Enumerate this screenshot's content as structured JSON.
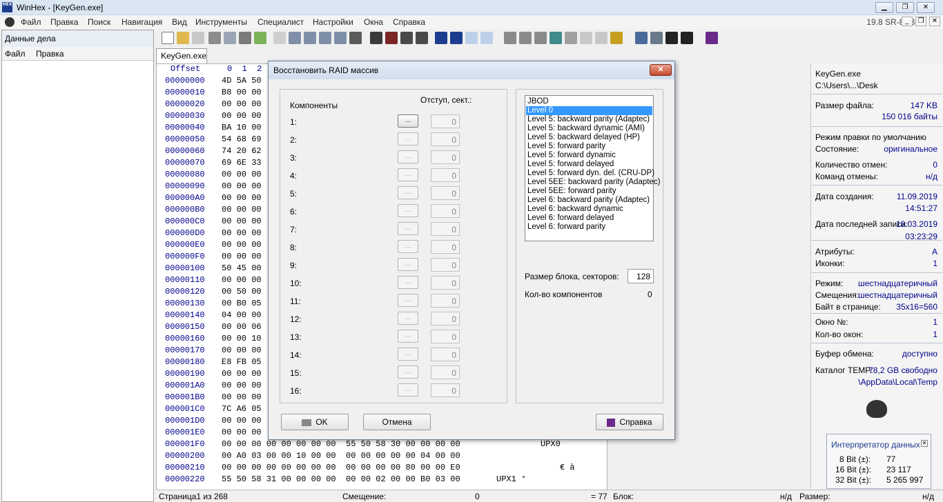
{
  "window": {
    "title": "WinHex - [KeyGen.exe]",
    "icon_text": "HEX"
  },
  "menu": [
    "Файл",
    "Правка",
    "Поиск",
    "Навигация",
    "Вид",
    "Инструменты",
    "Специалист",
    "Настройки",
    "Окна",
    "Справка"
  ],
  "version": "19.8 SR-8 x86",
  "case_panel": {
    "title": "Данные дела",
    "menu": [
      "Файл",
      "Правка"
    ]
  },
  "tab": "KeyGen.exe",
  "hex": {
    "header": {
      "offset": "Offset",
      "cols": "0  1  2"
    },
    "offsets": [
      "00000000",
      "00000010",
      "00000020",
      "00000030",
      "00000040",
      "00000050",
      "00000060",
      "00000070",
      "00000080",
      "00000090",
      "000000A0",
      "000000B0",
      "000000C0",
      "000000D0",
      "000000E0",
      "000000F0",
      "00000100",
      "00000110",
      "00000120",
      "00000130",
      "00000140",
      "00000150",
      "00000160",
      "00000170",
      "00000180",
      "00000190",
      "000001A0",
      "000001B0",
      "000001C0",
      "000001D0",
      "000001E0",
      "000001F0",
      "00000200",
      "00000210",
      "00000220"
    ],
    "bytes": [
      "4D 5A 50",
      "B8 00 00",
      "00 00 00",
      "00 00 00",
      "BA 10 00",
      "54 68 69",
      "74 20 62",
      "69 6E 33",
      "00 00 00",
      "00 00 00",
      "00 00 00",
      "00 00 00",
      "00 00 00",
      "00 00 00",
      "00 00 00",
      "00 00 00",
      "50 45 00",
      "00 00 00",
      "00 50 00",
      "00 B0 05",
      "04 00 00",
      "00 00 06",
      "00 00 10",
      "00 00 00",
      "E8 FB 05",
      "00 00 00",
      "00 00 00",
      "00 00 00",
      "7C A6 05",
      "00 00 00",
      "00 00 00",
      "00 00 00 00 00 00 00 00  55 50 58 30 00 00 00 00",
      "00 A0 03 00 00 10 00 00  00 00 00 00 00 04 00 00",
      "00 00 00 00 00 00 00 00  00 00 00 00 80 00 00 E0",
      "55 50 58 31 00 00 00 00  00 00 02 00 00 B0 03 00"
    ],
    "ascii": [
      "UPX0",
      "€  à",
      "UPX1     °"
    ]
  },
  "sidebar": {
    "file_name": "KeyGen.exe",
    "path": "C:\\Users\\...\\Desk",
    "rows": [
      {
        "label": "Размер файла:",
        "value": "147 KB"
      },
      {
        "label": "",
        "value": "150 016 байты"
      },
      {
        "label": "Режим правки по умолчанию",
        "value": ""
      },
      {
        "label": "Состояние:",
        "value": "оригинальное"
      },
      {
        "label": "Количество отмен:",
        "value": "0"
      },
      {
        "label": "Команд отмены:",
        "value": "н/д"
      },
      {
        "label": "Дата создания:",
        "value": "11.09.2019"
      },
      {
        "label": "",
        "value": "14:51:27"
      },
      {
        "label": "Дата последней записи:",
        "value": "18.03.2019"
      },
      {
        "label": "",
        "value": "03:23:29"
      },
      {
        "label": "Атрибуты:",
        "value": "A"
      },
      {
        "label": "Иконки:",
        "value": "1"
      },
      {
        "label": "Режим:",
        "value": "шестнадцатеричный"
      },
      {
        "label": "Смещения:",
        "value": "шестнадцатеричный"
      },
      {
        "label": "Байт в странице:",
        "value": "35x16=560"
      },
      {
        "label": "Окно №:",
        "value": "1"
      },
      {
        "label": "Кол-во окон:",
        "value": "1"
      },
      {
        "label": "Буфер обмена:",
        "value": "доступно"
      },
      {
        "label": "Каталог TEMP:",
        "value": "78,2 GB свободно"
      },
      {
        "label": "",
        "value": "\\AppData\\Local\\Temp"
      }
    ]
  },
  "interpreter": {
    "title": "Интерпретатор данных",
    "rows": [
      {
        "label": "8 Bit (±):",
        "value": "77"
      },
      {
        "label": "16 Bit (±):",
        "value": "23 117"
      },
      {
        "label": "32 Bit (±):",
        "value": "5 265 997"
      }
    ]
  },
  "status": {
    "page": "Страница1 из 268",
    "offset_label": "Смещение:",
    "offset_value": "0",
    "eq": "= 77",
    "block_label": "Блок:",
    "block_value": "н/д",
    "size_label": "Размер:",
    "size_value": "н/д"
  },
  "dialog": {
    "title": "Восстановить RAID массив",
    "components_label": "Компоненты",
    "offset_label": "Отступ, сект.:",
    "components": [
      "1:",
      "2:",
      "3:",
      "4:",
      "5:",
      "6:",
      "7:",
      "8:",
      "9:",
      "10:",
      "11:",
      "12:",
      "13:",
      "14:",
      "15:",
      "16:"
    ],
    "browse_label": "...",
    "offset_default": "0",
    "raid_levels": [
      "JBOD",
      "Level 0",
      "Level 5: backward parity (Adaptec)",
      "Level 5: backward dynamic (AMI)",
      "Level 5: backward delayed (HP)",
      "Level 5: forward parity",
      "Level 5: forward dynamic",
      "Level 5: forward delayed",
      "Level 5: forward dyn. del. (CRU-DP)",
      "Level 5EE: backward parity (Adaptec)",
      "Level 5EE: forward parity",
      "Level 6: backward parity (Adaptec)",
      "Level 6: backward dynamic",
      "Level 6: forward delayed",
      "Level 6: forward parity"
    ],
    "selected_level": "Level 0",
    "block_size_label": "Размер блока, секторов:",
    "block_size_value": "128",
    "count_label": "Кол-во компонентов",
    "count_value": "0",
    "ok": "OK",
    "cancel": "Отмена",
    "help": "Справка"
  },
  "colors": {
    "accent": "#00008b",
    "selection": "#3399ff",
    "titlebar": "#dbe6f3"
  }
}
